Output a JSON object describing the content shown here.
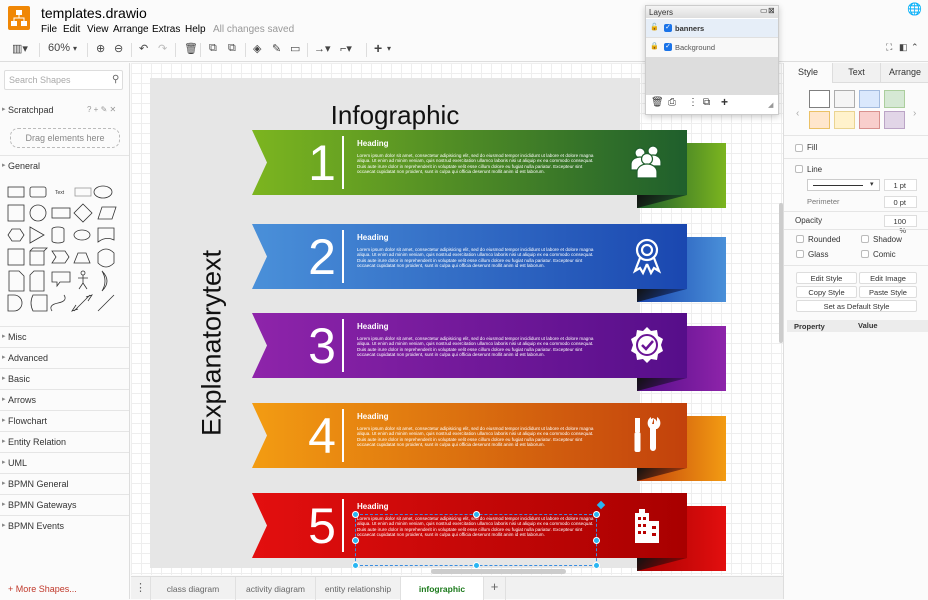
{
  "app": {
    "title": "templates.drawio",
    "menu": [
      "File",
      "Edit",
      "View",
      "Arrange",
      "Extras",
      "Help"
    ],
    "status": "All changes saved",
    "accent": "#f08705"
  },
  "toolbar": {
    "zoom": "60%"
  },
  "sidebar": {
    "search_placeholder": "Search Shapes",
    "scratchpad": "Scratchpad",
    "scratchpad_actions": "? + ✎ ✕",
    "drag_hint": "Drag elements here",
    "general": "General",
    "sections": [
      "Misc",
      "Advanced",
      "Basic",
      "Arrows",
      "Flowchart",
      "Entity Relation",
      "UML",
      "BPMN General",
      "BPMN Gateways",
      "BPMN Events"
    ],
    "more_shapes": "+ More Shapes..."
  },
  "diagram": {
    "title": "Infographic",
    "side_text": "Explanatorytext",
    "banners": [
      {
        "number": "1",
        "heading": "Heading",
        "icon": "users-icon",
        "color_light": "#7cb51f",
        "color_dark": "#1f5f2c"
      },
      {
        "number": "2",
        "heading": "Heading",
        "icon": "award-ribbon-icon",
        "color_light": "#4a90d9",
        "color_dark": "#1a47b0"
      },
      {
        "number": "3",
        "heading": "Heading",
        "icon": "badge-check-icon",
        "color_light": "#8e24aa",
        "color_dark": "#560e8a"
      },
      {
        "number": "4",
        "heading": "Heading",
        "icon": "tools-icon",
        "color_light": "#f39c12",
        "color_dark": "#c2410c"
      },
      {
        "number": "5",
        "heading": "Heading",
        "icon": "buildings-icon",
        "color_light": "#e30f0f",
        "color_dark": "#a80000"
      }
    ],
    "body_text": "Lorem ipsum dolor sit amet, consectetur adipisicing elit, sed do eiusmod tempor incididunt ut labore et dolore magna aliqua. Ut enim ad minim veniam, quis nostrud exercitation ullamco laboris nisi ut aliquip ex ea commodo consequat. Duis aute irure dolor in reprehenderit in voluptate velit esse cillum dolore eu fugiat nulla pariatur. Excepteur sint occaecat cupidatat non proident, sunt in culpa qui officia deserunt mollit anim id est laborum."
  },
  "layers": {
    "title": "Layers",
    "items": [
      {
        "name": "banners",
        "checked": true,
        "locked": false
      },
      {
        "name": "Background",
        "checked": true,
        "locked": true
      }
    ]
  },
  "format": {
    "tabs": [
      "Style",
      "Text",
      "Arrange"
    ],
    "swatches": [
      [
        "#ffffff",
        "#000000"
      ],
      [
        "#f5f5f5",
        "#666666"
      ],
      [
        "#dae8fc",
        "#6c8ebf"
      ],
      [
        "#d5e8d4",
        "#82b366"
      ],
      [
        "#ffe6cc",
        "#d79b00"
      ],
      [
        "#fff2cc",
        "#d6b656"
      ],
      [
        "#f8cecc",
        "#b85450"
      ],
      [
        "#e1d5e7",
        "#9673a6"
      ]
    ],
    "fill": "Fill",
    "line": "Line",
    "line_width": "1 pt",
    "perimeter": "Perimeter",
    "perimeter_value": "0 pt",
    "opacity": "Opacity",
    "opacity_value": "100 %",
    "rounded": "Rounded",
    "shadow": "Shadow",
    "glass": "Glass",
    "comic": "Comic",
    "edit_style": "Edit Style",
    "edit_image": "Edit Image",
    "copy_style": "Copy Style",
    "paste_style": "Paste Style",
    "default_style": "Set as Default Style",
    "property": "Property",
    "value": "Value"
  },
  "pages": {
    "tabs": [
      "class diagram",
      "activity diagram",
      "entity relationship",
      "infographic"
    ],
    "active": "infographic"
  }
}
